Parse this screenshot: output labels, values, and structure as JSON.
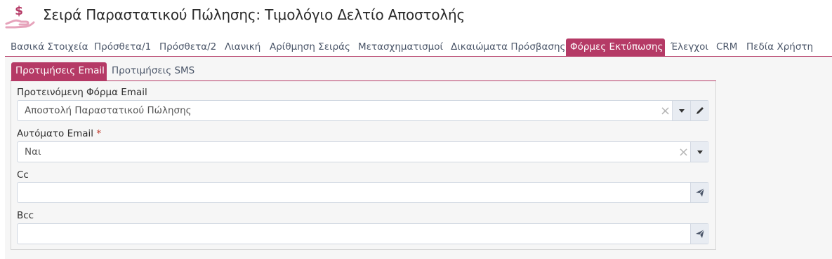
{
  "header": {
    "title": "Σειρά Παραστατικού Πώλησης: Τιμολόγιο Δελτίο Αποστολής",
    "logo_icon": "money-hand-icon",
    "logo_symbol": "$"
  },
  "tabs": [
    {
      "label": "Βασικά Στοιχεία",
      "active": false
    },
    {
      "label": "Πρόσθετα/1",
      "active": false
    },
    {
      "label": "Πρόσθετα/2",
      "active": false
    },
    {
      "label": "Λιανική",
      "active": false
    },
    {
      "label": "Αρίθμηση Σειράς",
      "active": false
    },
    {
      "label": "Μετασχηματισμοί",
      "active": false
    },
    {
      "label": "Δικαιώματα Πρόσβασης",
      "active": false
    },
    {
      "label": "Φόρμες Εκτύπωσης",
      "active": true
    },
    {
      "label": "Έλεγχοι",
      "active": false
    },
    {
      "label": "CRM",
      "active": false
    },
    {
      "label": "Πεδία Χρήστη",
      "active": false
    }
  ],
  "subtabs": [
    {
      "label": "Προτιμήσεις Email",
      "active": true
    },
    {
      "label": "Προτιμήσεις SMS",
      "active": false
    }
  ],
  "form": {
    "email_form": {
      "label": "Προτεινόμενη Φόρμα Email",
      "value": "Αποστολή Παραστατικού Πώλησης",
      "icons": [
        "clear-icon",
        "dropdown-icon",
        "edit-icon"
      ]
    },
    "auto_email": {
      "label": "Αυτόματο Email",
      "required_mark": "*",
      "value": "Ναι",
      "icons": [
        "clear-icon",
        "dropdown-icon"
      ]
    },
    "cc": {
      "label": "Cc",
      "value": "",
      "icons": [
        "send-icon"
      ]
    },
    "bcc": {
      "label": "Bcc",
      "value": "",
      "icons": [
        "send-icon"
      ]
    }
  },
  "colors": {
    "accent": "#b53a66",
    "panel_bg": "#f6f6f6",
    "button_bg": "#e8ecf2"
  }
}
